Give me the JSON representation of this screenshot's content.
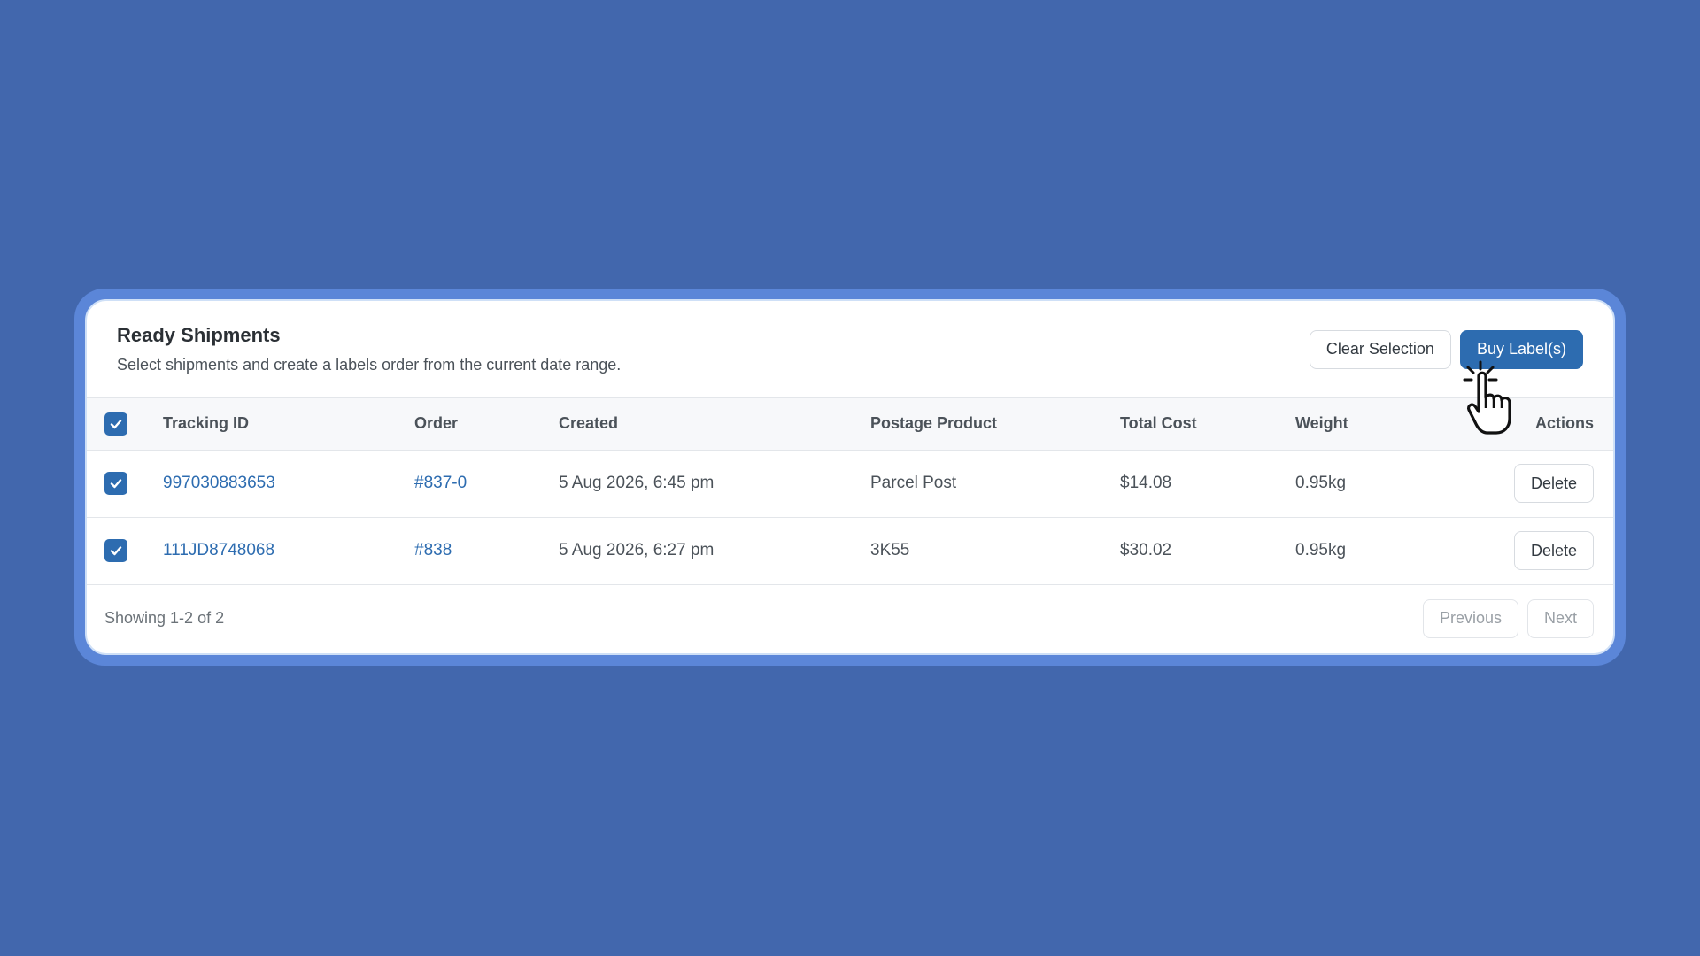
{
  "header": {
    "title": "Ready Shipments",
    "subtitle": "Select shipments and create a labels order from the current date range.",
    "clear_label": "Clear Selection",
    "buy_label": "Buy Label(s)"
  },
  "table": {
    "columns": [
      "Tracking ID",
      "Order",
      "Created",
      "Postage Product",
      "Total Cost",
      "Weight",
      "Actions"
    ],
    "rows": [
      {
        "checked": true,
        "tracking_id": "997030883653",
        "order": "#837-0",
        "created": "5 Aug 2026, 6:45 pm",
        "postage": "Parcel Post",
        "cost": "$14.08",
        "weight": "0.95kg",
        "action": "Delete"
      },
      {
        "checked": true,
        "tracking_id": "111JD8748068",
        "order": "#838",
        "created": "5 Aug 2026, 6:27 pm",
        "postage": "3K55",
        "cost": "$30.02",
        "weight": "0.95kg",
        "action": "Delete"
      }
    ]
  },
  "footer": {
    "showing": "Showing 1-2 of 2",
    "previous": "Previous",
    "next": "Next"
  },
  "colors": {
    "background": "#4267ad",
    "accent": "#2d6cb0"
  },
  "icons": {
    "checkbox": "checkmark-icon",
    "cursor": "hand-pointer-icon"
  }
}
